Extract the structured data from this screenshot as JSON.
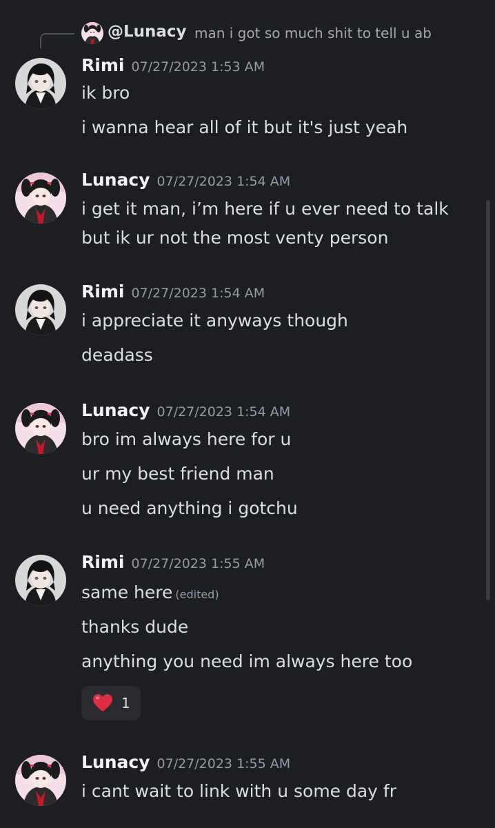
{
  "reply": {
    "author": "@Lunacy",
    "preview": "man i got so much shit to tell u ab"
  },
  "messages": [
    {
      "author": "Rimi",
      "timestamp": "07/27/2023 1:53 AM",
      "lines": [
        "ik bro",
        "i wanna hear all of it but it's just yeah"
      ]
    },
    {
      "author": "Lunacy",
      "timestamp": "07/27/2023 1:54 AM",
      "lines": [
        "i get it man, i’m here if u ever need to talk",
        "but ik ur not the most venty person"
      ]
    },
    {
      "author": "Rimi",
      "timestamp": "07/27/2023 1:54 AM",
      "lines": [
        "i appreciate it anyways though",
        "deadass"
      ]
    },
    {
      "author": "Lunacy",
      "timestamp": "07/27/2023 1:54 AM",
      "lines": [
        "bro im always here for u",
        "ur my best friend man",
        "u need anything i gotchu"
      ]
    },
    {
      "author": "Rimi",
      "timestamp": "07/27/2023 1:55 AM",
      "lines": [
        "same here",
        "thanks dude",
        "anything you need im always here too"
      ],
      "edited_label": "(edited)",
      "reaction": {
        "emoji": "heart-emoji",
        "count": "1"
      }
    },
    {
      "author": "Lunacy",
      "timestamp": "07/27/2023 1:55 AM",
      "lines": [
        "i cant wait to link with u some day fr"
      ]
    }
  ],
  "colors": {
    "background": "#1d1e22",
    "author": "#f2f3f5",
    "timestamp": "#949ba4",
    "text": "#dbdee1",
    "reaction_bg": "#2a2b31"
  }
}
